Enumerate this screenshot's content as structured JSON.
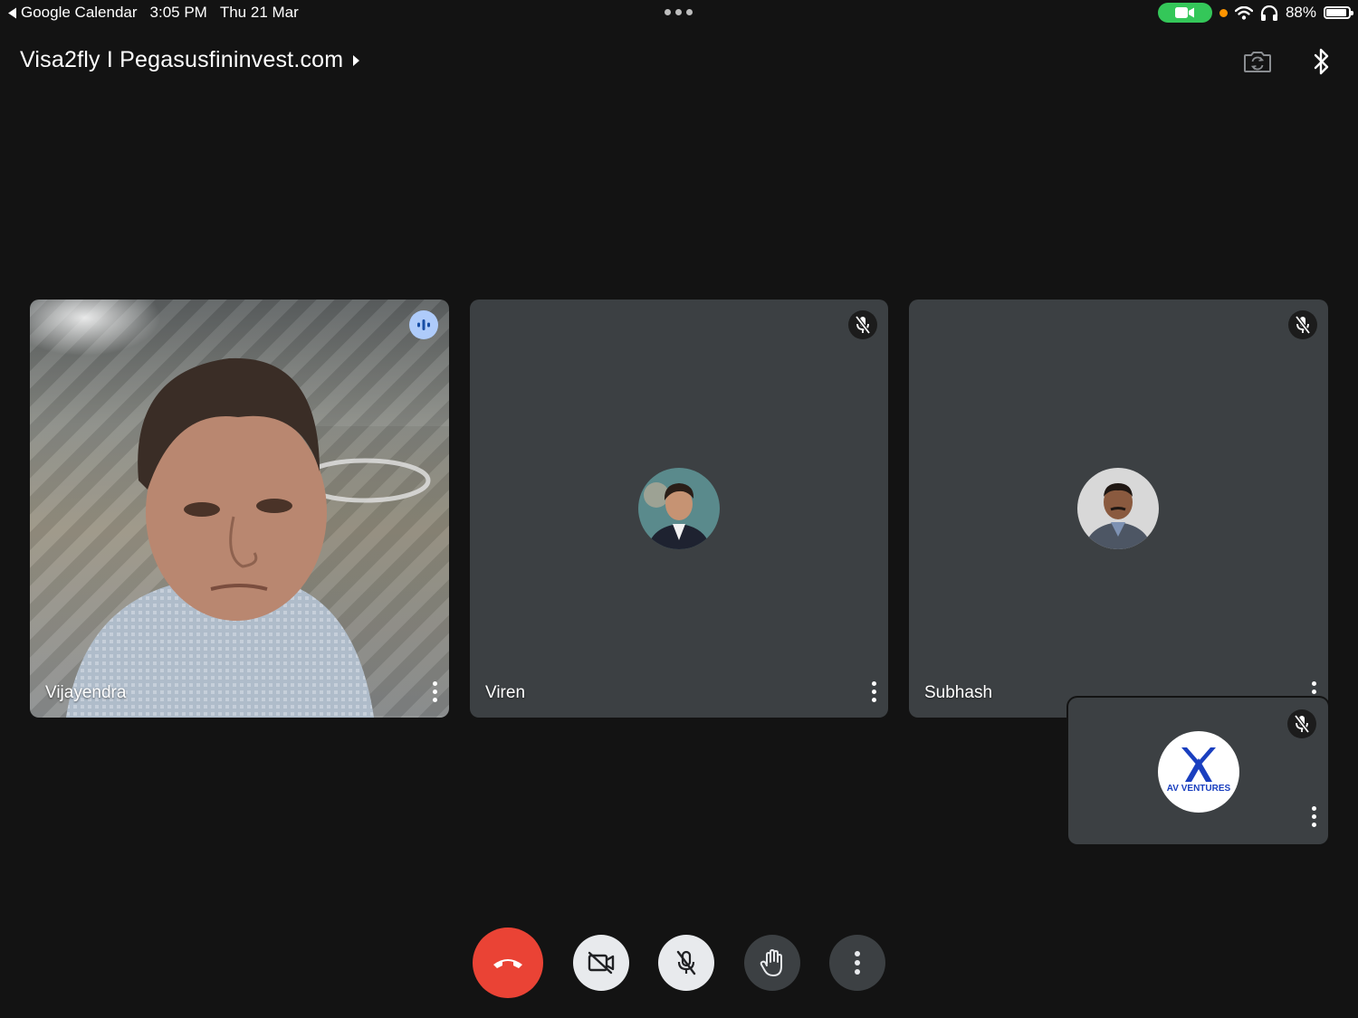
{
  "status_bar": {
    "back_app": "Google Calendar",
    "time": "3:05 PM",
    "date": "Thu 21 Mar",
    "battery": "88%",
    "battery_level": 0.88
  },
  "meeting": {
    "title": "Visa2fly I Pegasusfininvest.com"
  },
  "participants": [
    {
      "name": "Vijayendra",
      "video_on": true,
      "speaking": true,
      "muted": false
    },
    {
      "name": "Viren",
      "video_on": false,
      "speaking": false,
      "muted": true
    },
    {
      "name": "Subhash",
      "video_on": false,
      "speaking": false,
      "muted": true
    },
    {
      "name": "",
      "video_on": false,
      "speaking": false,
      "muted": true,
      "logo_text": "AV VENTURES"
    }
  ],
  "controls": {
    "icons": [
      "end-call-icon",
      "camera-off-icon",
      "mic-off-icon",
      "raise-hand-icon",
      "more-vert-icon"
    ]
  },
  "colors": {
    "background": "#131313",
    "tile": "#3c4043",
    "end_call": "#ea4335",
    "speaking_badge": "#aecbfa",
    "camera_indicator": "#34c759",
    "logo_blue": "#1a3fbf"
  }
}
